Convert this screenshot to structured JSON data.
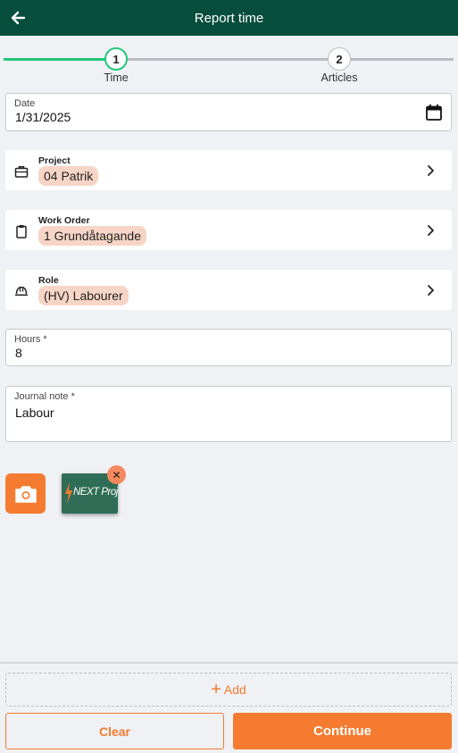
{
  "header": {
    "title": "Report time",
    "back_icon": "arrow-left-icon"
  },
  "stepper": {
    "steps": [
      {
        "number": "1",
        "label": "Time",
        "state": "active"
      },
      {
        "number": "2",
        "label": "Articles",
        "state": "pending"
      }
    ]
  },
  "date": {
    "label": "Date",
    "value": "1/31/2025",
    "icon": "calendar-icon"
  },
  "project": {
    "label": "Project",
    "value": "04 Patrik",
    "icon": "briefcase-icon"
  },
  "work_order": {
    "label": "Work Order",
    "value": "1 Grundåtagande",
    "icon": "clipboard-icon"
  },
  "role": {
    "label": "Role",
    "value": "(HV) Labourer",
    "icon": "hard-hat-icon"
  },
  "hours": {
    "label": "Hours *",
    "value": "8"
  },
  "journal_note": {
    "label": "Journal note *",
    "value": "Labour"
  },
  "attachments": {
    "camera_icon": "camera-icon",
    "items": [
      {
        "logo_text": "NEXT Project",
        "remove_icon": "close-icon"
      }
    ]
  },
  "footer": {
    "add_label": "Add",
    "clear_label": "Clear",
    "continue_label": "Continue"
  },
  "colors": {
    "header_bg": "#064e3b",
    "accent": "#f47b2f",
    "progress": "#21c87a",
    "chip_bg": "#f7d5c6",
    "page_bg": "#f0f1f4"
  }
}
